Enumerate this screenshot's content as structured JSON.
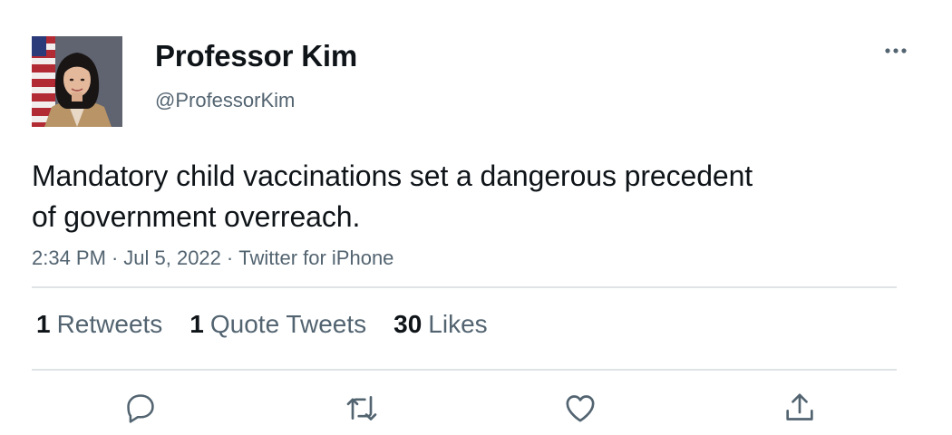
{
  "author": {
    "name": "Professor Kim",
    "handle": "@ProfessorKim",
    "avatar_icon": "profile-photo"
  },
  "tweet": {
    "text_lines": [
      "Mandatory child vaccinations set a dangerous precedent",
      "of government overreach."
    ],
    "time": "2:34 PM",
    "separator": "·",
    "date": "Jul 5, 2022",
    "source": "Twitter for iPhone"
  },
  "stats": [
    {
      "count": "1",
      "label": "Retweets"
    },
    {
      "count": "1",
      "label": "Quote Tweets"
    },
    {
      "count": "30",
      "label": "Likes"
    }
  ],
  "actions": [
    {
      "icon": "reply-icon"
    },
    {
      "icon": "retweet-icon"
    },
    {
      "icon": "like-icon"
    },
    {
      "icon": "share-icon"
    }
  ],
  "colors": {
    "text_primary": "#0f1419",
    "text_secondary": "#536471",
    "divider": "#dfe3e6",
    "icon": "#536471"
  }
}
